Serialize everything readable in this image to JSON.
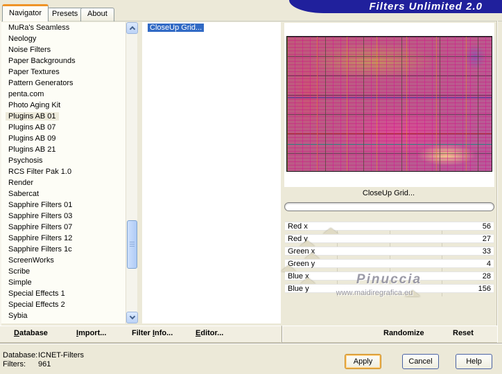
{
  "window": {
    "title": "Filters Unlimited 2.0"
  },
  "colors": {
    "banner_navy": "#20209C",
    "selection_blue": "#316AC5",
    "tab_highlight_orange": "#EF9326",
    "apply_focus_orange": "#E5A01A",
    "dialog_beige": "#ECE9D8"
  },
  "tabs": [
    {
      "label": "Navigator",
      "active": true
    },
    {
      "label": "Presets",
      "active": false
    },
    {
      "label": "About",
      "active": false
    }
  ],
  "navigator_list": {
    "selected_index": 8,
    "items": [
      "MuRa's Seamless",
      "Neology",
      "Noise Filters",
      "Paper Backgrounds",
      "Paper Textures",
      "Pattern Generators",
      "penta.com",
      "Photo Aging Kit",
      "Plugins AB 01",
      "Plugins AB 07",
      "Plugins AB 09",
      "Plugins AB 21",
      "Psychosis",
      "RCS Filter Pak 1.0",
      "Render",
      "Sabercat",
      "Sapphire Filters 01",
      "Sapphire Filters 03",
      "Sapphire Filters 07",
      "Sapphire Filters 12",
      "Sapphire Filters 1c",
      "ScreenWorks",
      "Scribe",
      "Simple",
      "Special Effects 1",
      "Special Effects 2",
      "Sybia"
    ]
  },
  "filter_list": {
    "selected_index": 0,
    "items": [
      "CloseUp Grid..."
    ]
  },
  "preview": {
    "filter_name": "CloseUp Grid...",
    "progress_percent": 0
  },
  "slider_max": 255,
  "sliders": [
    {
      "label": "Red x",
      "value": 56
    },
    {
      "label": "Red y",
      "value": 27
    },
    {
      "label": "Green x",
      "value": 33
    },
    {
      "label": "Green y",
      "value": 4
    },
    {
      "label": "Blue x",
      "value": 28
    },
    {
      "label": "Blue y",
      "value": 156
    }
  ],
  "watermark": {
    "line1": "Pinuccia",
    "line2": "www.maidiregrafica.eu"
  },
  "menu": {
    "items": [
      {
        "pre": "",
        "key": "D",
        "post": "atabase"
      },
      {
        "pre": "",
        "key": "I",
        "post": "mport..."
      },
      {
        "pre": "Filter ",
        "key": "I",
        "post": "nfo..."
      },
      {
        "pre": "",
        "key": "E",
        "post": "ditor..."
      }
    ]
  },
  "param_buttons": [
    {
      "label": "Randomize"
    },
    {
      "label": "Reset"
    }
  ],
  "status": {
    "database_label": "Database:",
    "database_value": "ICNET-Filters",
    "filters_label": "Filters:",
    "filters_value": "961"
  },
  "action_buttons": [
    {
      "label": "Apply",
      "default": true
    },
    {
      "label": "Cancel",
      "default": false
    },
    {
      "label": "Help",
      "default": false
    }
  ]
}
